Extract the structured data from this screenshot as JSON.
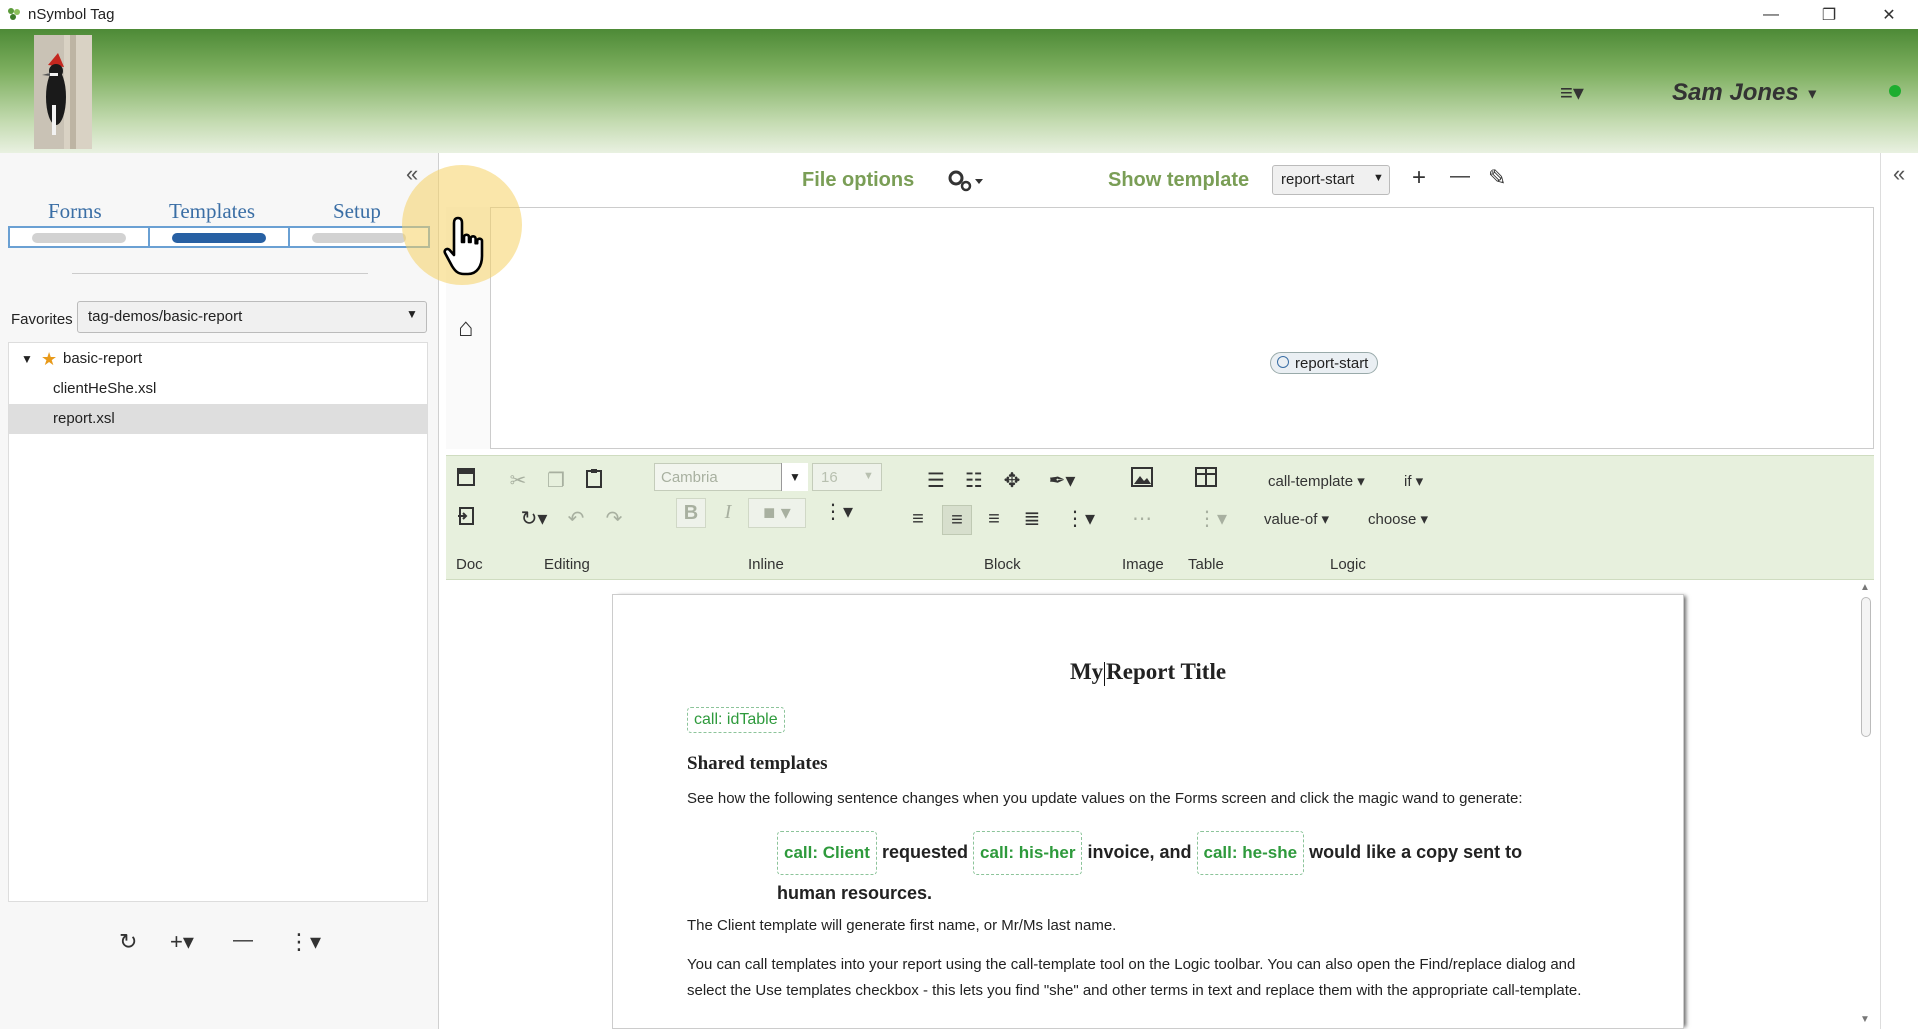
{
  "window": {
    "title": "nSymbol Tag",
    "minimize": "—",
    "restore": "❐",
    "close": "✕"
  },
  "header": {
    "user_name": "Sam Jones",
    "user_caret": "▼",
    "menu_icon": "≡▾"
  },
  "left_panel": {
    "collapse_icon": "«",
    "tabs": [
      {
        "label": "Forms"
      },
      {
        "label": "Templates"
      },
      {
        "label": "Setup"
      }
    ],
    "favorites_label": "Favorites",
    "favorites_value": "tag-demos/basic-report",
    "tree": {
      "root": "basic-report",
      "children": [
        "clientHeShe.xsl",
        "report.xsl"
      ],
      "selected": "report.xsl"
    },
    "bottom_buttons": {
      "refresh": "↻",
      "add": "+▾",
      "remove": "—",
      "more": "⋮▾"
    }
  },
  "main": {
    "file_options_label": "File options",
    "show_template_label": "Show template",
    "template_select_value": "report-start",
    "add_icon": "+",
    "minus_icon": "—",
    "edit_icon": "✎",
    "diagram_node": "report-start",
    "home_icon": "⌂"
  },
  "toolbar": {
    "groups": {
      "doc": "Doc",
      "editing": "Editing",
      "inline": "Inline",
      "block": "Block",
      "image": "Image",
      "table": "Table",
      "logic": "Logic"
    },
    "font_name": "Cambria",
    "font_size": "16",
    "bold": "B",
    "italic": "I",
    "logic_call_template": "call-template",
    "logic_if": "if",
    "logic_value_of": "value-of",
    "logic_choose": "choose"
  },
  "document": {
    "title_before_cursor": "My",
    "title_after_cursor": "Report Title",
    "chip_idtable": "call: idTable",
    "heading": "Shared templates",
    "para1": "See how the following sentence changes when you update values on the Forms screen and click the magic wand to generate:",
    "sentence": {
      "chip_client": "call: Client",
      "w1": "requested",
      "chip_hisher": "call: his-her",
      "w2": "invoice, and",
      "chip_heshe": "call: he-she",
      "w3": "would like a copy sent to",
      "line2": "human resources."
    },
    "para2": "The Client template will generate first name, or Mr/Ms last name.",
    "para3a": "You can call templates into your report using the call-template tool on the Logic toolbar. You can also open the Find/replace dialog and",
    "para3b": "select the Use templates checkbox - this lets you find \"she\" and other terms in text and replace them with the appropriate call-template."
  },
  "colors": {
    "accent_green": "#7a9e56",
    "tab_blue": "#3a6ea5",
    "chip_green": "#2e9a3c",
    "online": "#1dae2f"
  }
}
